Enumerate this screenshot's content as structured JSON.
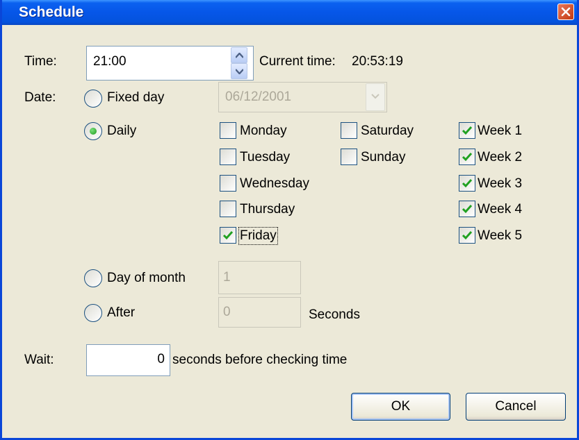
{
  "window": {
    "title": "Schedule",
    "close_icon": "close-icon"
  },
  "time": {
    "label": "Time:",
    "value": "21:00",
    "current_label": "Current time:",
    "current_value": "20:53:19"
  },
  "date": {
    "label": "Date:",
    "fixed_day": {
      "label": "Fixed day",
      "checked": false,
      "value": "06/12/2001"
    },
    "daily": {
      "label": "Daily",
      "checked": true
    },
    "day_of_month": {
      "label": "Day of month",
      "checked": false,
      "value": "1"
    },
    "after": {
      "label": "After",
      "checked": false,
      "value": "0",
      "unit": "Seconds"
    }
  },
  "days": [
    {
      "label": "Monday",
      "checked": false
    },
    {
      "label": "Tuesday",
      "checked": false
    },
    {
      "label": "Wednesday",
      "checked": false
    },
    {
      "label": "Thursday",
      "checked": false
    },
    {
      "label": "Friday",
      "checked": true
    },
    {
      "label": "Saturday",
      "checked": false
    },
    {
      "label": "Sunday",
      "checked": false
    }
  ],
  "weeks": [
    {
      "label": "Week 1",
      "checked": true
    },
    {
      "label": "Week 2",
      "checked": true
    },
    {
      "label": "Week 3",
      "checked": true
    },
    {
      "label": "Week 4",
      "checked": true
    },
    {
      "label": "Week 5",
      "checked": true
    }
  ],
  "wait": {
    "label": "Wait:",
    "value": "0",
    "suffix": "seconds before checking time"
  },
  "buttons": {
    "ok": "OK",
    "cancel": "Cancel"
  },
  "colors": {
    "titlebar": "#0656e8",
    "dialog_bg": "#ece9d8",
    "check": "#21a121",
    "close": "#c3390f"
  }
}
